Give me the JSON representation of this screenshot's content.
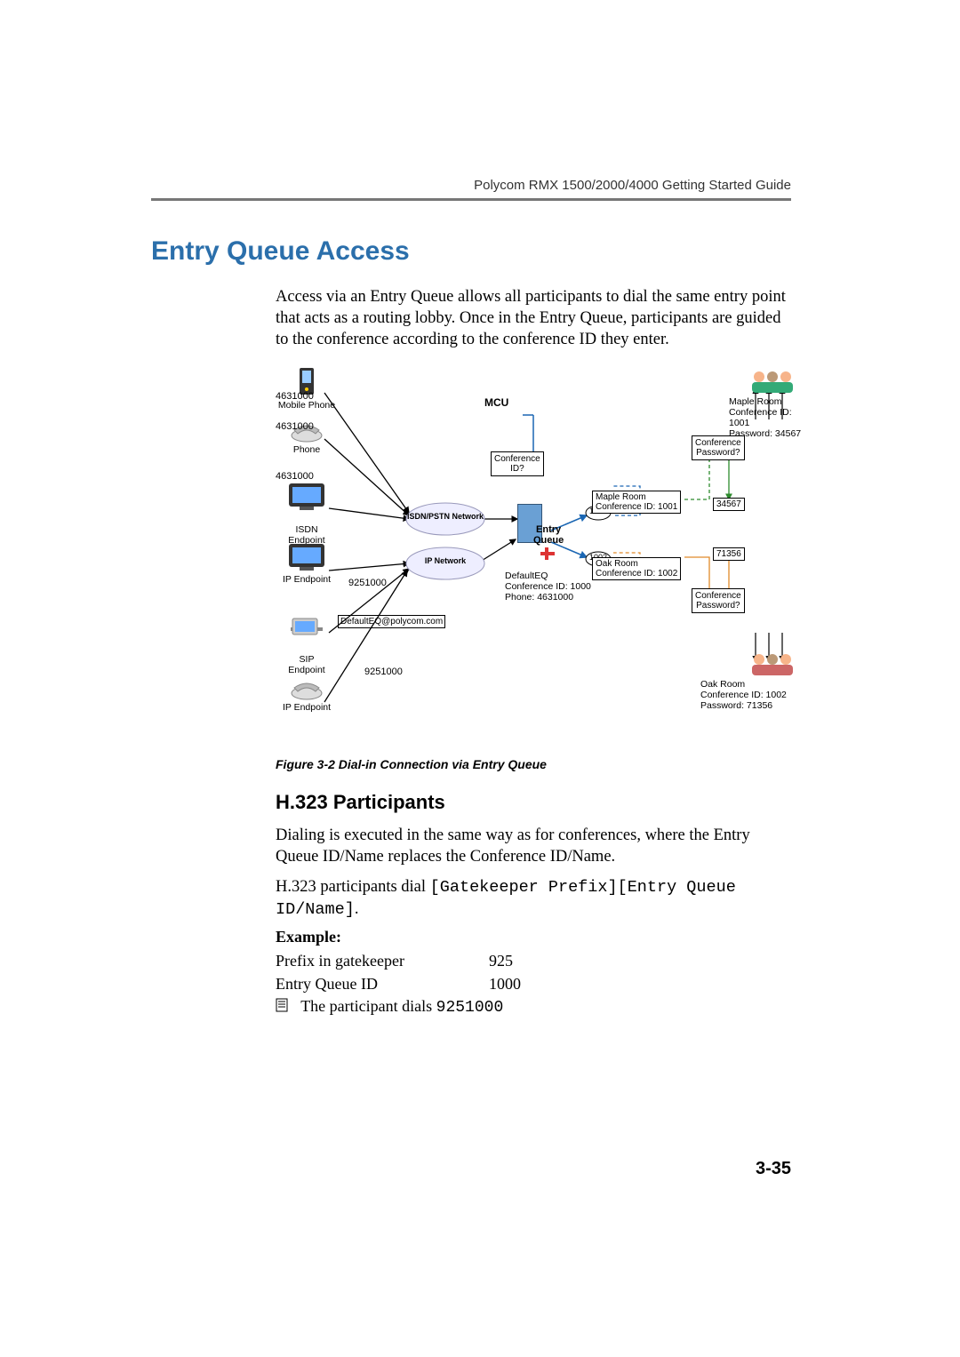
{
  "header": {
    "running": "Polycom RMX 1500/2000/4000 Getting Started Guide"
  },
  "title": "Entry Queue Access",
  "intro": "Access via an Entry Queue allows all participants to dial the same entry point that acts as a routing lobby. Once in the Entry Queue, participants are guided to the conference according to the conference ID they enter.",
  "figure_caption": "Figure 3-2  Dial-in Connection via Entry Queue",
  "subhead": "H.323 Participants",
  "h323_para1": "Dialing is executed in the same way as for conferences, where the Entry Queue ID/Name replaces the Conference ID/Name.",
  "h323_para2_prefix": "H.323 participants dial ",
  "h323_para2_code": "[Gatekeeper Prefix][Entry Queue ID/Name]",
  "h323_para2_suffix": ".",
  "example": {
    "label": "Example:",
    "row1": {
      "k": "Prefix in gatekeeper",
      "v": "925"
    },
    "row2": {
      "k": "Entry Queue ID",
      "v": "1000"
    },
    "bullet_text": "The participant dials ",
    "bullet_code": "9251000"
  },
  "page_num": "3-35",
  "diagram": {
    "devices": {
      "mobile_phone": "Mobile Phone",
      "phone": "Phone",
      "isdn_endpoint": "ISDN\nEndpoint",
      "ip_endpoint_top": "IP Endpoint",
      "sip_endpoint": "SIP\nEndpoint",
      "ip_endpoint_bottom": "IP Endpoint"
    },
    "dial_numbers": {
      "mobile": "4631000",
      "phone": "4631000",
      "isdn": "4631000",
      "ip_top": "9251000",
      "sip": "DefaultEQ@polycom.com",
      "ip_bottom": "9251000"
    },
    "mcu_label": "MCU",
    "clouds": {
      "isdn": "ISDN/PSTN Network",
      "ip": "IP Network"
    },
    "entry_queue_label": "Entry\nQueue",
    "eq_info": "DefaultEQ\nConference ID: 1000\nPhone: 4631000",
    "prompts": {
      "conf_id": "Conference\nID?",
      "conf_pw_top": "Conference\nPassword?",
      "conf_pw_bottom": "Conference\nPassword?"
    },
    "conf_id_send": {
      "id1001": "1001",
      "id1002": "1002"
    },
    "rooms": {
      "maple_box": "Maple Room\nConference ID: 1001",
      "oak_box": "Oak Room\nConference ID: 1002",
      "maple_result": "Maple Room\nConference ID: 1001\nPassword: 34567",
      "oak_result": "Oak Room\nConference ID: 1002\nPassword: 71356"
    },
    "pw_answers": {
      "maple": "34567",
      "oak": "71356"
    }
  }
}
